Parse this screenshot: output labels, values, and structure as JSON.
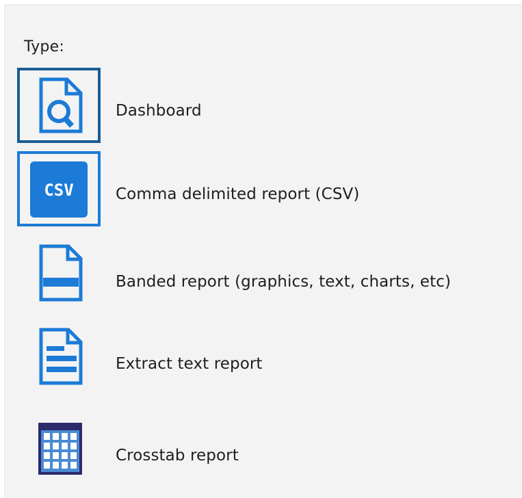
{
  "type_label": "Type:",
  "options": [
    {
      "label": "Dashboard",
      "icon": "dashboard-magnifier-icon",
      "selected": true
    },
    {
      "label": "Comma delimited report (CSV)",
      "icon": "csv-icon",
      "focused": true,
      "icon_text": "CSV"
    },
    {
      "label": "Banded report (graphics, text, charts, etc)",
      "icon": "banded-report-icon"
    },
    {
      "label": "Extract text report",
      "icon": "extract-text-report-icon"
    },
    {
      "label": "Crosstab report",
      "icon": "crosstab-grid-icon"
    }
  ],
  "colors": {
    "icon_blue": "#1c7bd6",
    "selected_border": "#1a5d93",
    "crosstab_navy": "#2b2a6b",
    "crosstab_blue": "#4a8ad4"
  }
}
